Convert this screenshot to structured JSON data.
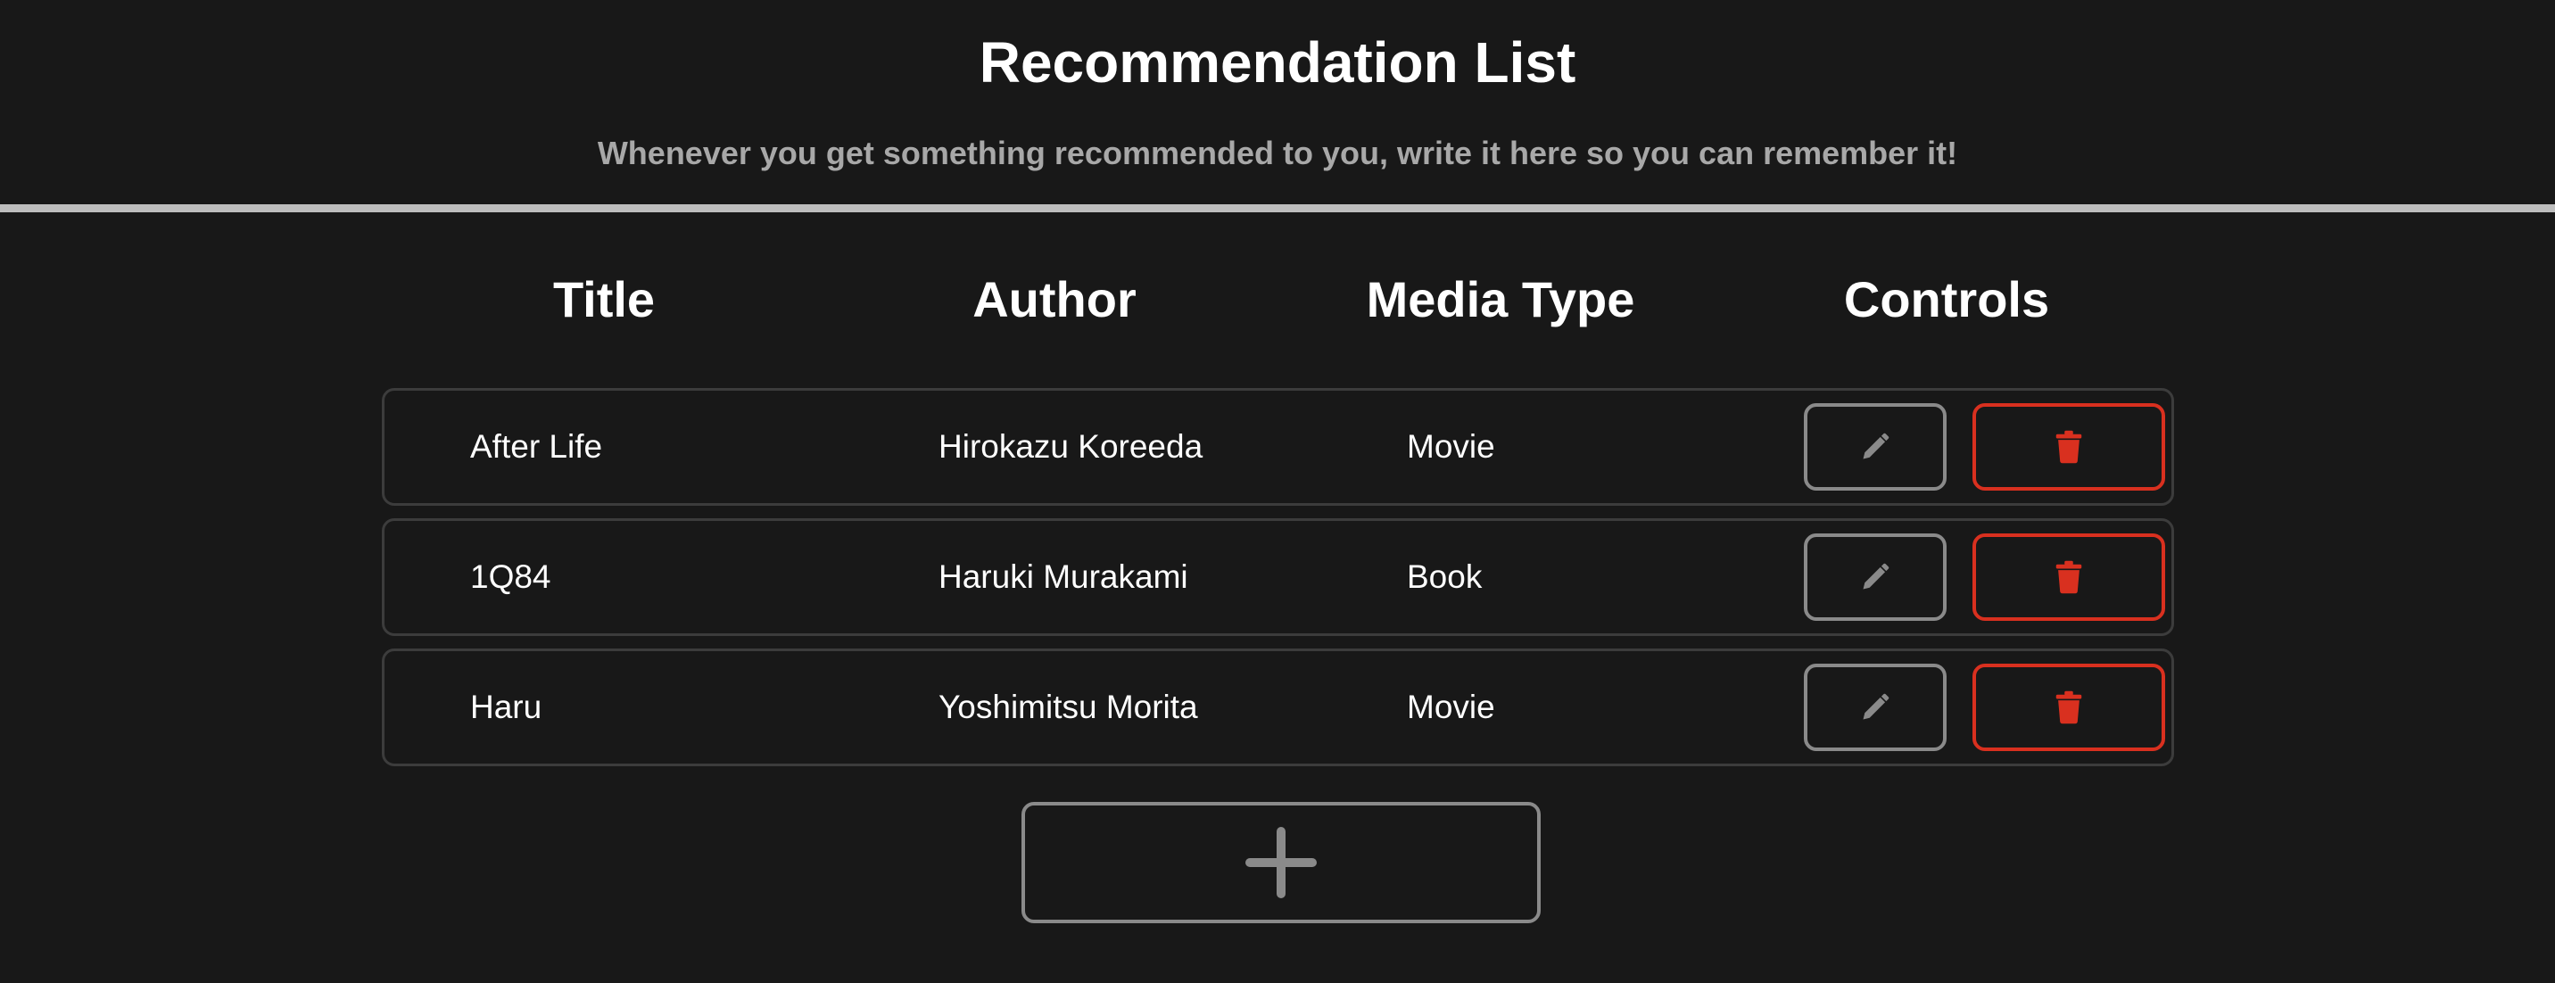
{
  "header": {
    "title": "Recommendation List",
    "subtitle": "Whenever you get something recommended to you, write it here so you can remember it!"
  },
  "table": {
    "columns": [
      "Title",
      "Author",
      "Media Type",
      "Controls"
    ],
    "rows": [
      {
        "title": "After Life",
        "author": "Hirokazu Koreeda",
        "media_type": "Movie"
      },
      {
        "title": "1Q84",
        "author": "Haruki Murakami",
        "media_type": "Book"
      },
      {
        "title": "Haru",
        "author": "Yoshimitsu Morita",
        "media_type": "Movie"
      }
    ]
  },
  "icons": {
    "edit": "pencil-icon",
    "delete": "trash-icon",
    "add": "plus-icon"
  },
  "colors": {
    "background": "#181818",
    "text": "#ffffff",
    "subtitle": "#a8a8a8",
    "border_neutral": "#8a8a8a",
    "row_border": "#3c3c3c",
    "danger": "#d9301f"
  }
}
